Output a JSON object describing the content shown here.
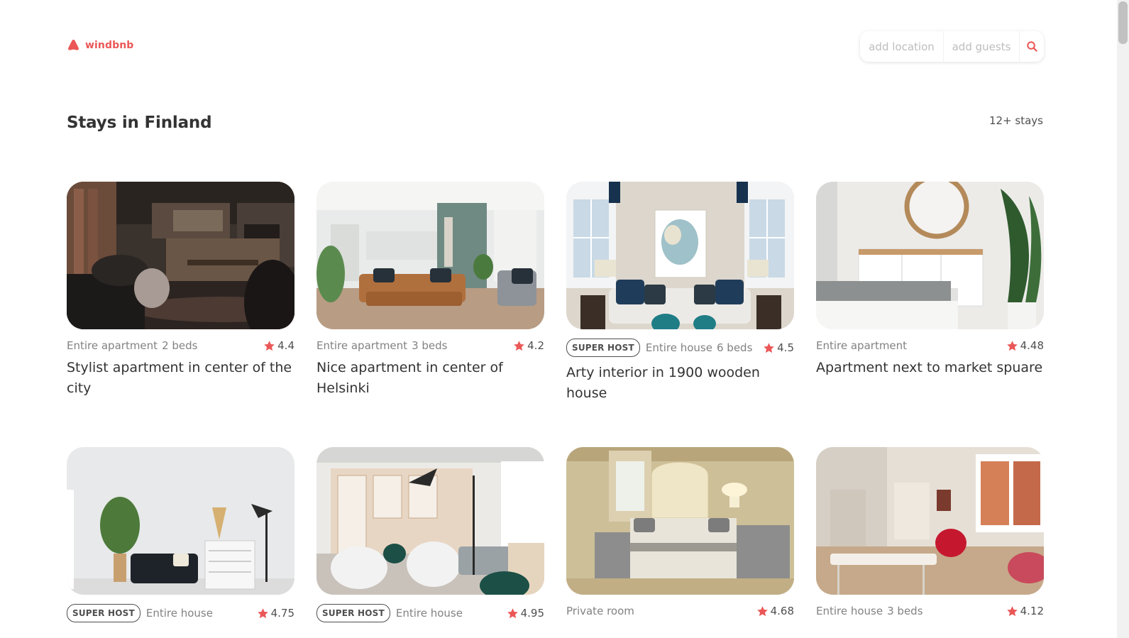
{
  "brand": {
    "name": "windbnb",
    "accent": "#eb5757"
  },
  "search": {
    "location_placeholder": "add location",
    "guests_placeholder": "add guests",
    "icon": "search-icon"
  },
  "page": {
    "title": "Stays in Finland",
    "count": "12+ stays"
  },
  "stays": [
    {
      "superhost": false,
      "badge": "",
      "type": "Entire apartment",
      "beds": "2 beds",
      "rating": "4.4",
      "title": "Stylist apartment in center of the city",
      "image": "loft living room with leather sofa"
    },
    {
      "superhost": false,
      "badge": "",
      "type": "Entire apartment",
      "beds": "3 beds",
      "rating": "4.2",
      "title": "Nice apartment in center of Helsinki",
      "image": "bright living room with tan sofa"
    },
    {
      "superhost": true,
      "badge": "SUPER HOST",
      "type": "Entire house",
      "beds": "6 beds",
      "rating": "4.5",
      "title": "Arty interior in 1900 wooden house",
      "image": "living room with white sofa and lamps"
    },
    {
      "superhost": false,
      "badge": "",
      "type": "Entire apartment",
      "beds": "",
      "rating": "4.48",
      "title": "Apartment next to market spuare",
      "image": "bedroom with dresser and mirror"
    },
    {
      "superhost": true,
      "badge": "SUPER HOST",
      "type": "Entire house",
      "beds": "",
      "rating": "4.75",
      "title": "",
      "image": "white room with dark sofa"
    },
    {
      "superhost": true,
      "badge": "SUPER HOST",
      "type": "Entire house",
      "beds": "",
      "rating": "4.95",
      "title": "",
      "image": "lounge with white chairs and floor lamp"
    },
    {
      "superhost": false,
      "badge": "",
      "type": "Private room",
      "beds": "",
      "rating": "4.68",
      "title": "",
      "image": "bedroom with upholstered headboard"
    },
    {
      "superhost": false,
      "badge": "",
      "type": "Entire house",
      "beds": "3 beds",
      "rating": "4.12",
      "title": "",
      "image": "studio with red armchair"
    }
  ]
}
